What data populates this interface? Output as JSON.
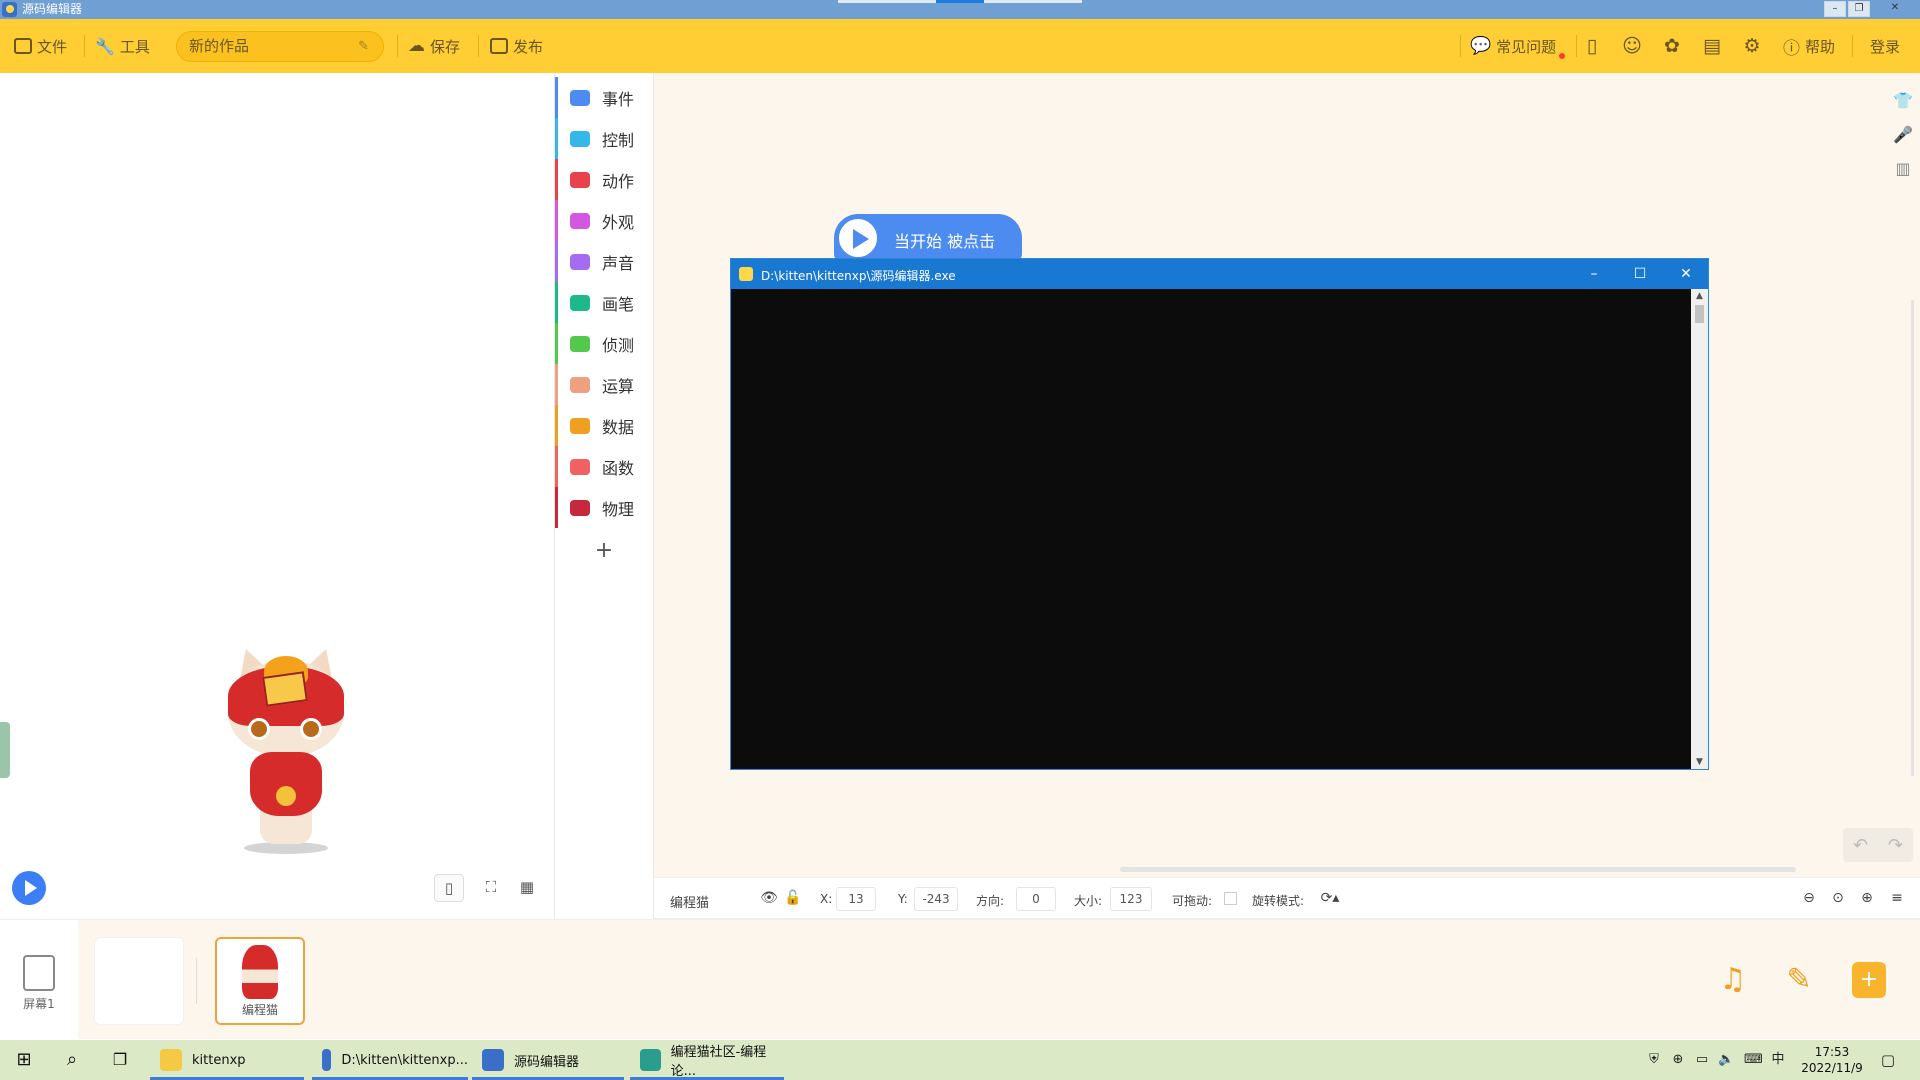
{
  "window": {
    "title": "源码编辑器",
    "minimize": "–",
    "restore": "❐",
    "close": "✕"
  },
  "toolbar": {
    "file": "文件",
    "tools": "工具",
    "work_name": "新的作品",
    "save": "保存",
    "publish": "发布",
    "faq": "常见问题",
    "help": "帮助",
    "login": "登录"
  },
  "categories": [
    {
      "label": "事件",
      "color": "#4c8cf0"
    },
    {
      "label": "控制",
      "color": "#35b7e8"
    },
    {
      "label": "动作",
      "color": "#e8424a"
    },
    {
      "label": "外观",
      "color": "#d457e0"
    },
    {
      "label": "声音",
      "color": "#a46cf0"
    },
    {
      "label": "画笔",
      "color": "#1db98a"
    },
    {
      "label": "侦测",
      "color": "#52c84c"
    },
    {
      "label": "运算",
      "color": "#f0a080"
    },
    {
      "label": "数据",
      "color": "#f0a020"
    },
    {
      "label": "函数",
      "color": "#f06262"
    },
    {
      "label": "物理",
      "color": "#c8283c"
    }
  ],
  "category_add": "+",
  "script": {
    "hat_block": "当开始 被点击"
  },
  "console": {
    "title": "D:\\kitten\\kittenxp\\源码编辑器.exe",
    "minimize": "–",
    "maximize": "☐",
    "close": "✕"
  },
  "properties": {
    "sprite_name": "编程猫",
    "x_label": "X:",
    "x_value": "13",
    "y_label": "Y:",
    "y_value": "-243",
    "direction_label": "方向:",
    "direction_value": "0",
    "size_label": "大小:",
    "size_value": "123",
    "draggable_label": "可拖动:",
    "rotation_label": "旋转模式:"
  },
  "tray": {
    "screen_label": "屏幕1",
    "sprite_label": "编程猫"
  },
  "taskbar": {
    "apps": [
      {
        "label": "kittenxp",
        "color": "#f6c945"
      },
      {
        "label": "D:\\kitten\\kittenxp...",
        "color": "#3a6fc7"
      },
      {
        "label": "源码编辑器",
        "color": "#3a6fc7"
      },
      {
        "label": "编程猫社区-编程论...",
        "color": "#2a9d8f"
      }
    ],
    "ime": "中",
    "time": "17:53",
    "date": "2022/11/9"
  },
  "colors": {
    "toolbar_bg": "#ffce34",
    "workspace_bg": "#fdf6ec",
    "accent_blue": "#4c8cf0",
    "console_bg": "#0c0c0c",
    "taskbar_bg": "#dbe9c6"
  }
}
